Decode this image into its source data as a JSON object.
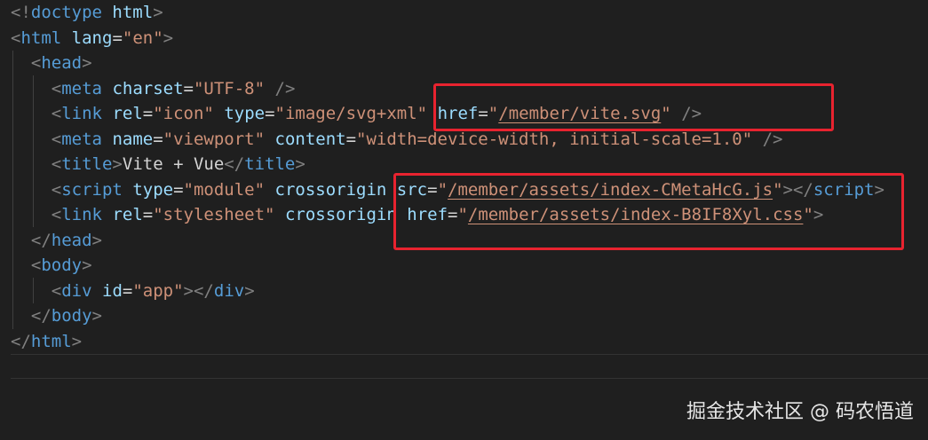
{
  "editor": {
    "lines": [
      [
        {
          "c": "tk-bracket",
          "t": "<!"
        },
        {
          "c": "tk-tag",
          "t": "doctype"
        },
        {
          "c": "tk-text",
          "t": " "
        },
        {
          "c": "tk-attr",
          "t": "html"
        },
        {
          "c": "tk-bracket",
          "t": ">"
        }
      ],
      [
        {
          "c": "tk-bracket",
          "t": "<"
        },
        {
          "c": "tk-tag",
          "t": "html"
        },
        {
          "c": "tk-text",
          "t": " "
        },
        {
          "c": "tk-attr",
          "t": "lang"
        },
        {
          "c": "tk-text",
          "t": "="
        },
        {
          "c": "tk-str",
          "t": "\"en\""
        },
        {
          "c": "tk-bracket",
          "t": ">"
        }
      ],
      [
        {
          "c": "tk-text",
          "t": "  "
        },
        {
          "c": "tk-bracket",
          "t": "<"
        },
        {
          "c": "tk-tag",
          "t": "head"
        },
        {
          "c": "tk-bracket",
          "t": ">"
        }
      ],
      [
        {
          "c": "tk-text",
          "t": "    "
        },
        {
          "c": "tk-bracket",
          "t": "<"
        },
        {
          "c": "tk-tag",
          "t": "meta"
        },
        {
          "c": "tk-text",
          "t": " "
        },
        {
          "c": "tk-attr",
          "t": "charset"
        },
        {
          "c": "tk-text",
          "t": "="
        },
        {
          "c": "tk-str",
          "t": "\"UTF-8\""
        },
        {
          "c": "tk-text",
          "t": " "
        },
        {
          "c": "tk-bracket",
          "t": "/>"
        }
      ],
      [
        {
          "c": "tk-text",
          "t": "    "
        },
        {
          "c": "tk-bracket",
          "t": "<"
        },
        {
          "c": "tk-tag",
          "t": "link"
        },
        {
          "c": "tk-text",
          "t": " "
        },
        {
          "c": "tk-attr",
          "t": "rel"
        },
        {
          "c": "tk-text",
          "t": "="
        },
        {
          "c": "tk-str",
          "t": "\"icon\""
        },
        {
          "c": "tk-text",
          "t": " "
        },
        {
          "c": "tk-attr",
          "t": "type"
        },
        {
          "c": "tk-text",
          "t": "="
        },
        {
          "c": "tk-str",
          "t": "\"image/svg+xml\""
        },
        {
          "c": "tk-text",
          "t": " "
        },
        {
          "c": "tk-attr",
          "t": "href"
        },
        {
          "c": "tk-text",
          "t": "="
        },
        {
          "c": "tk-str",
          "t": "\""
        },
        {
          "c": "tk-link",
          "t": "/member/vite.svg"
        },
        {
          "c": "tk-str",
          "t": "\""
        },
        {
          "c": "tk-text",
          "t": " "
        },
        {
          "c": "tk-bracket",
          "t": "/>"
        }
      ],
      [
        {
          "c": "tk-text",
          "t": "    "
        },
        {
          "c": "tk-bracket",
          "t": "<"
        },
        {
          "c": "tk-tag",
          "t": "meta"
        },
        {
          "c": "tk-text",
          "t": " "
        },
        {
          "c": "tk-attr",
          "t": "name"
        },
        {
          "c": "tk-text",
          "t": "="
        },
        {
          "c": "tk-str",
          "t": "\"viewport\""
        },
        {
          "c": "tk-text",
          "t": " "
        },
        {
          "c": "tk-attr",
          "t": "content"
        },
        {
          "c": "tk-text",
          "t": "="
        },
        {
          "c": "tk-str",
          "t": "\"width=device-width, initial-scale=1.0\""
        },
        {
          "c": "tk-text",
          "t": " "
        },
        {
          "c": "tk-bracket",
          "t": "/>"
        }
      ],
      [
        {
          "c": "tk-text",
          "t": "    "
        },
        {
          "c": "tk-bracket",
          "t": "<"
        },
        {
          "c": "tk-tag",
          "t": "title"
        },
        {
          "c": "tk-bracket",
          "t": ">"
        },
        {
          "c": "tk-text",
          "t": "Vite + Vue"
        },
        {
          "c": "tk-bracket",
          "t": "</"
        },
        {
          "c": "tk-tag",
          "t": "title"
        },
        {
          "c": "tk-bracket",
          "t": ">"
        }
      ],
      [
        {
          "c": "tk-text",
          "t": "    "
        },
        {
          "c": "tk-bracket",
          "t": "<"
        },
        {
          "c": "tk-tag",
          "t": "script"
        },
        {
          "c": "tk-text",
          "t": " "
        },
        {
          "c": "tk-attr",
          "t": "type"
        },
        {
          "c": "tk-text",
          "t": "="
        },
        {
          "c": "tk-str",
          "t": "\"module\""
        },
        {
          "c": "tk-text",
          "t": " "
        },
        {
          "c": "tk-attr",
          "t": "crossorigin"
        },
        {
          "c": "tk-text",
          "t": " "
        },
        {
          "c": "tk-attr",
          "t": "src"
        },
        {
          "c": "tk-text",
          "t": "="
        },
        {
          "c": "tk-str",
          "t": "\""
        },
        {
          "c": "tk-link",
          "t": "/member/assets/index-CMetaHcG.js"
        },
        {
          "c": "tk-str",
          "t": "\""
        },
        {
          "c": "tk-bracket",
          "t": "></"
        },
        {
          "c": "tk-tag",
          "t": "script"
        },
        {
          "c": "tk-bracket",
          "t": ">"
        }
      ],
      [
        {
          "c": "tk-text",
          "t": "    "
        },
        {
          "c": "tk-bracket",
          "t": "<"
        },
        {
          "c": "tk-tag",
          "t": "link"
        },
        {
          "c": "tk-text",
          "t": " "
        },
        {
          "c": "tk-attr",
          "t": "rel"
        },
        {
          "c": "tk-text",
          "t": "="
        },
        {
          "c": "tk-str",
          "t": "\"stylesheet\""
        },
        {
          "c": "tk-text",
          "t": " "
        },
        {
          "c": "tk-attr",
          "t": "crossorigin"
        },
        {
          "c": "tk-text",
          "t": " "
        },
        {
          "c": "tk-attr",
          "t": "href"
        },
        {
          "c": "tk-text",
          "t": "="
        },
        {
          "c": "tk-str",
          "t": "\""
        },
        {
          "c": "tk-link",
          "t": "/member/assets/index-B8IF8Xyl.css"
        },
        {
          "c": "tk-str",
          "t": "\""
        },
        {
          "c": "tk-bracket",
          "t": ">"
        }
      ],
      [
        {
          "c": "tk-text",
          "t": "  "
        },
        {
          "c": "tk-bracket",
          "t": "</"
        },
        {
          "c": "tk-tag",
          "t": "head"
        },
        {
          "c": "tk-bracket",
          "t": ">"
        }
      ],
      [
        {
          "c": "tk-text",
          "t": "  "
        },
        {
          "c": "tk-bracket",
          "t": "<"
        },
        {
          "c": "tk-tag",
          "t": "body"
        },
        {
          "c": "tk-bracket",
          "t": ">"
        }
      ],
      [
        {
          "c": "tk-text",
          "t": "    "
        },
        {
          "c": "tk-bracket",
          "t": "<"
        },
        {
          "c": "tk-tag",
          "t": "div"
        },
        {
          "c": "tk-text",
          "t": " "
        },
        {
          "c": "tk-attr",
          "t": "id"
        },
        {
          "c": "tk-text",
          "t": "="
        },
        {
          "c": "tk-str",
          "t": "\"app\""
        },
        {
          "c": "tk-bracket",
          "t": "></"
        },
        {
          "c": "tk-tag",
          "t": "div"
        },
        {
          "c": "tk-bracket",
          "t": ">"
        }
      ],
      [
        {
          "c": "tk-text",
          "t": "  "
        },
        {
          "c": "tk-bracket",
          "t": "</"
        },
        {
          "c": "tk-tag",
          "t": "body"
        },
        {
          "c": "tk-bracket",
          "t": ">"
        }
      ],
      [
        {
          "c": "tk-bracket",
          "t": "</"
        },
        {
          "c": "tk-tag",
          "t": "html"
        },
        {
          "c": "tk-bracket",
          "t": ">"
        }
      ]
    ]
  },
  "watermark": {
    "text": "掘金技术社区 @ 码农悟道"
  },
  "colors": {
    "background": "#1f1f1f",
    "tag": "#569cd6",
    "attribute": "#9cdcfe",
    "string": "#ce9178",
    "bracket": "#808080",
    "text": "#d4d4d4",
    "highlight_box": "#e8232f"
  }
}
